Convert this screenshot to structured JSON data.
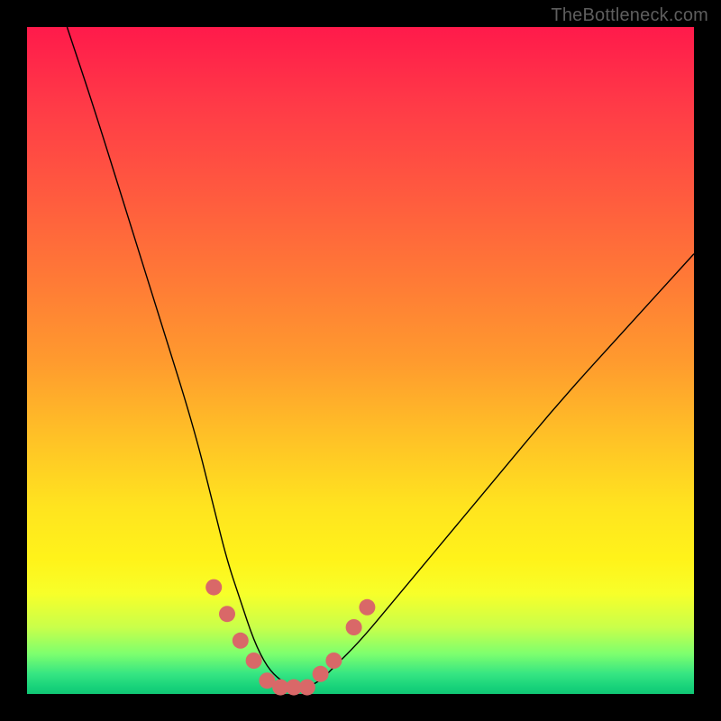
{
  "watermark": "TheBottleneck.com",
  "chart_data": {
    "type": "line",
    "title": "",
    "xlabel": "",
    "ylabel": "",
    "xlim": [
      0,
      100
    ],
    "ylim": [
      0,
      100
    ],
    "grid": false,
    "legend": false,
    "series": [
      {
        "name": "bottleneck-curve",
        "x": [
          6,
          10,
          15,
          20,
          25,
          28,
          30,
          32,
          34,
          36,
          38,
          40,
          42,
          44,
          46,
          50,
          55,
          60,
          65,
          70,
          80,
          90,
          100
        ],
        "y": [
          100,
          88,
          72,
          56,
          40,
          28,
          20,
          14,
          8,
          4,
          2,
          1,
          1,
          2,
          4,
          8,
          14,
          20,
          26,
          32,
          44,
          55,
          66
        ]
      }
    ],
    "markers": [
      {
        "name": "left-arm-dot-1",
        "x": 28,
        "y": 16
      },
      {
        "name": "left-arm-dot-2",
        "x": 30,
        "y": 12
      },
      {
        "name": "left-arm-dot-3",
        "x": 32,
        "y": 8
      },
      {
        "name": "left-arm-dot-4",
        "x": 34,
        "y": 5
      },
      {
        "name": "trough-dot-1",
        "x": 36,
        "y": 2
      },
      {
        "name": "trough-dot-2",
        "x": 38,
        "y": 1
      },
      {
        "name": "trough-dot-3",
        "x": 40,
        "y": 1
      },
      {
        "name": "trough-dot-4",
        "x": 42,
        "y": 1
      },
      {
        "name": "right-arm-dot-1",
        "x": 44,
        "y": 3
      },
      {
        "name": "right-arm-dot-2",
        "x": 46,
        "y": 5
      },
      {
        "name": "right-arm-dot-3",
        "x": 49,
        "y": 10
      },
      {
        "name": "right-arm-dot-4",
        "x": 51,
        "y": 13
      }
    ],
    "marker_style": {
      "color": "#d96868",
      "radius_px": 9
    }
  }
}
